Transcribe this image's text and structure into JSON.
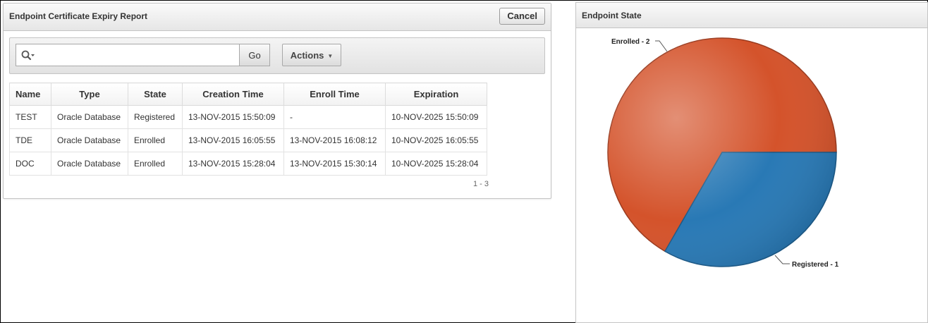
{
  "report": {
    "title": "Endpoint Certificate Expiry Report",
    "cancel_label": "Cancel",
    "search": {
      "value": "",
      "placeholder": ""
    },
    "go_label": "Go",
    "actions_label": "Actions",
    "columns": [
      "Name",
      "Type",
      "State",
      "Creation Time",
      "Enroll Time",
      "Expiration"
    ],
    "rows": [
      [
        "TEST",
        "Oracle Database",
        "Registered",
        "13-NOV-2015 15:50:09",
        "-",
        "10-NOV-2025 15:50:09"
      ],
      [
        "TDE",
        "Oracle Database",
        "Enrolled",
        "13-NOV-2015 16:05:55",
        "13-NOV-2015 16:08:12",
        "10-NOV-2025 16:05:55"
      ],
      [
        "DOC",
        "Oracle Database",
        "Enrolled",
        "13-NOV-2015 15:28:04",
        "13-NOV-2015 15:30:14",
        "10-NOV-2025 15:28:04"
      ]
    ],
    "pagination": "1 - 3"
  },
  "chart_region": {
    "title": "Endpoint State"
  },
  "chart_data": {
    "type": "pie",
    "title": "",
    "categories": [
      "Enrolled",
      "Registered"
    ],
    "values": [
      2,
      1
    ],
    "labels": [
      "Enrolled - 2",
      "Registered - 1"
    ],
    "colors": [
      "#d4532b",
      "#2979b5"
    ],
    "legend": "none"
  }
}
